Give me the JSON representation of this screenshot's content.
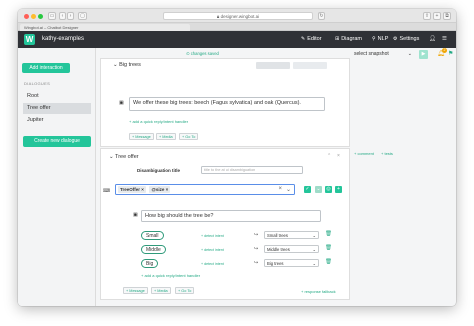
{
  "browser": {
    "url": "designer.wingbot.ai",
    "tab_title": "Wingbot.ai – Chatbot Designer"
  },
  "header": {
    "logo_letter": "W",
    "project": "kathy-examples",
    "nav": [
      {
        "icon": "✎",
        "label": "Editor"
      },
      {
        "icon": "⊞",
        "label": "Diagram"
      },
      {
        "icon": "⚲",
        "label": "NLP"
      },
      {
        "icon": "⚙",
        "label": "Settings"
      }
    ],
    "notification_count": "2"
  },
  "sidebar": {
    "add_interaction": "Add interaction",
    "section_title": "DIALOGUES",
    "items": [
      {
        "label": "Root",
        "active": false
      },
      {
        "label": "Tree offer",
        "active": true
      },
      {
        "label": "Jupiter",
        "active": false
      }
    ],
    "create_dialogue": "Create new dialogue"
  },
  "toolbar": {
    "changes_saved": "changes saved",
    "snapshot_placeholder": "select snapshot"
  },
  "card1": {
    "title": "Big trees",
    "message": "We offer these big trees: beech (Fagus sylvatica) and oak (Quercus).",
    "add_reply": "add a quick reply/intent handler",
    "buttons": [
      "Message",
      "Media",
      "Go To"
    ]
  },
  "card2": {
    "title": "Tree offer",
    "disambiguation_label": "Disambiguation title",
    "disambiguation_placeholder": "title to the at ui disambiguation",
    "tags": [
      "TreeOffer",
      "@size"
    ],
    "message": "How big should the tree be?",
    "replies": [
      {
        "label": "Small",
        "target": "Small trees"
      },
      {
        "label": "Middle",
        "target": "Middle trees"
      },
      {
        "label": "Big",
        "target": "Big trees"
      }
    ],
    "detect_intent": "detect intent",
    "add_reply": "add a quick reply/intent handler",
    "buttons": [
      "Message",
      "Media",
      "Go To"
    ],
    "response_fallback": "response fallback"
  },
  "side_links": {
    "comment": "comment",
    "tests": "tests"
  },
  "colors": {
    "accent": "#23c59a",
    "header_bg": "#2f3136"
  }
}
